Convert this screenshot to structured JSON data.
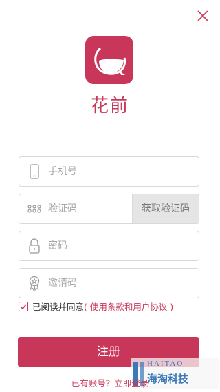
{
  "brand": {
    "name": "花前"
  },
  "form": {
    "phone_placeholder": "手机号",
    "code_placeholder": "验证码",
    "code_button": "获取验证码",
    "password_placeholder": "密码",
    "invite_placeholder": "邀请码"
  },
  "agreement": {
    "checked": true,
    "prefix": "已阅读并同意",
    "terms": "( 使用条款和用户协议 )"
  },
  "register_label": "注册",
  "login_link": "已有账号？立即登录",
  "watermark": {
    "en": "HAITAO",
    "cn": "海淘科技"
  },
  "colors": {
    "accent": "#c8375a"
  }
}
